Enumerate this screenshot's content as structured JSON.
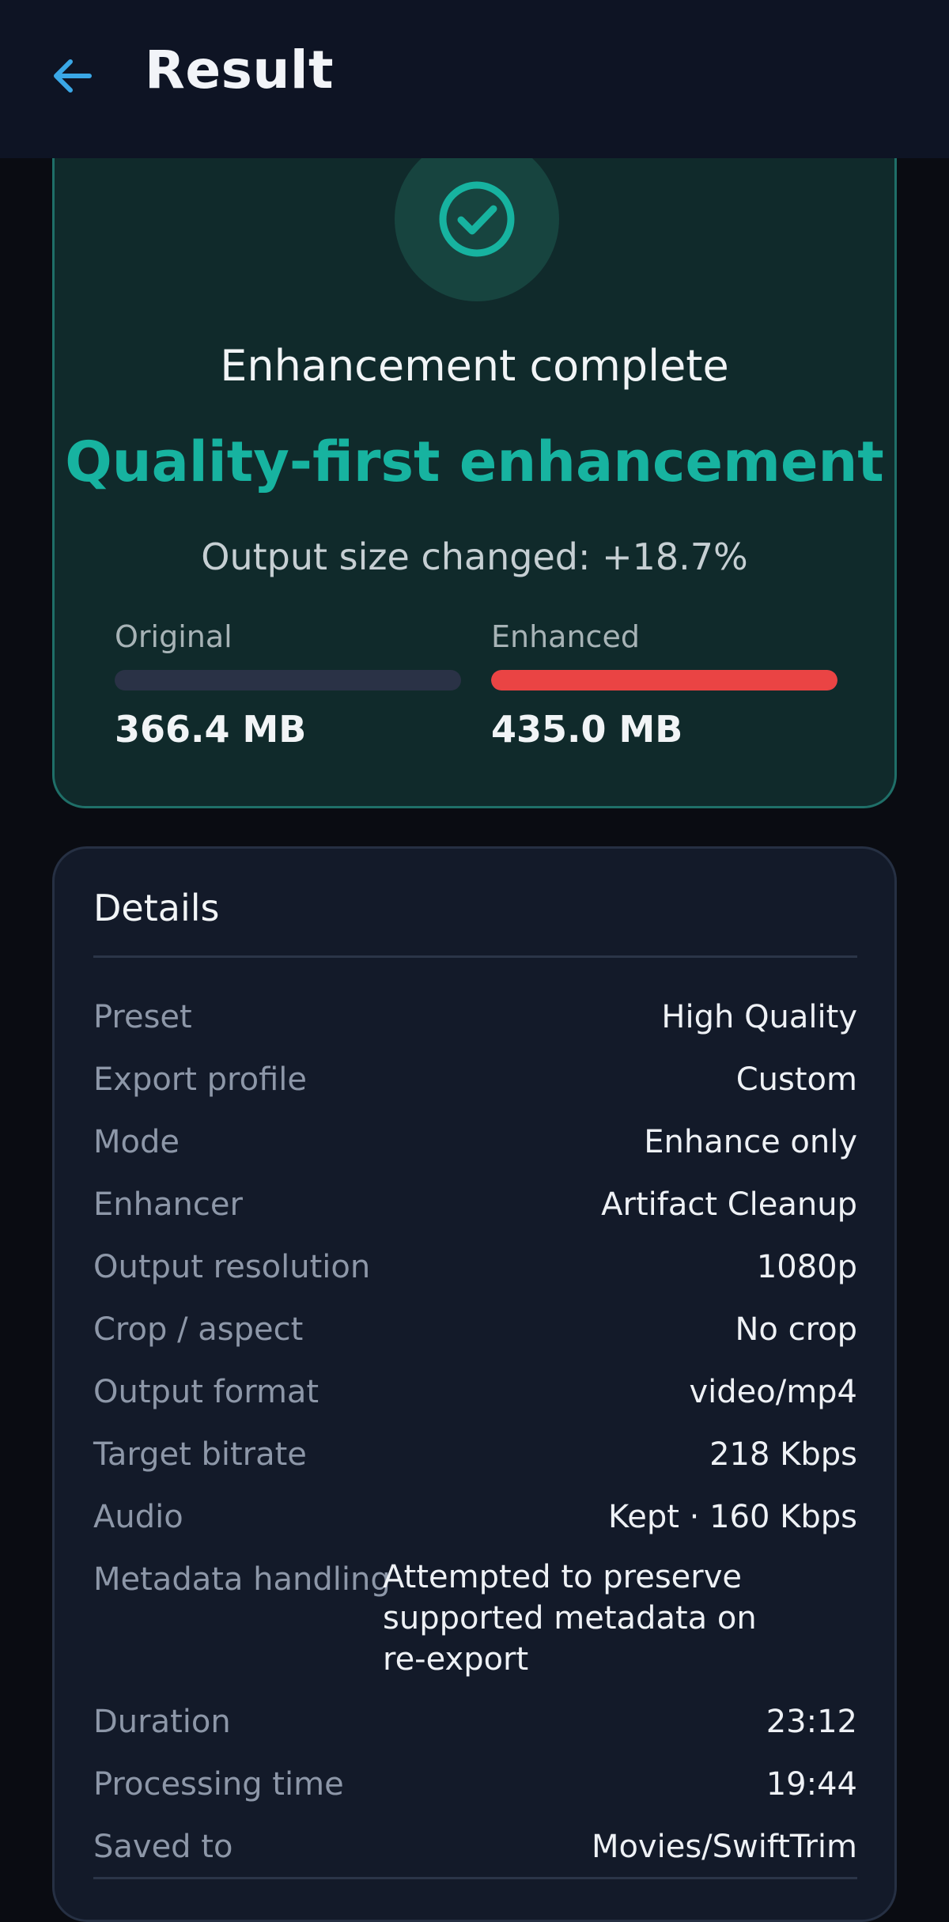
{
  "app_bar": {
    "title": "Result",
    "back_icon": "arrow-left-icon",
    "accent_color": "#3aa7e6"
  },
  "result": {
    "status_icon": "check-circle-icon",
    "title": "Enhancement complete",
    "headline": "Quality-first enhancement",
    "size_change": "Output size changed: +18.7%",
    "original": {
      "label": "Original",
      "value": "366.4 MB",
      "bar_fraction": 0.0,
      "bar_color": "#2a3246"
    },
    "enhanced": {
      "label": "Enhanced",
      "value": "435.0 MB",
      "bar_fraction": 1.0,
      "bar_color": "#ea4444"
    },
    "accent_color": "#17b3a0"
  },
  "details": {
    "title": "Details",
    "rows": [
      {
        "key": "Preset",
        "value": "High Quality"
      },
      {
        "key": "Export profile",
        "value": "Custom"
      },
      {
        "key": "Mode",
        "value": "Enhance only"
      },
      {
        "key": "Enhancer",
        "value": "Artifact Cleanup"
      },
      {
        "key": "Output resolution",
        "value": "1080p"
      },
      {
        "key": "Crop / aspect",
        "value": "No crop"
      },
      {
        "key": "Output format",
        "value": "video/mp4"
      },
      {
        "key": "Target bitrate",
        "value": "218 Kbps"
      },
      {
        "key": "Audio",
        "value": "Kept · 160 Kbps"
      },
      {
        "key": "Metadata handling",
        "value": "Attempted to preserve supported metadata on re-export"
      },
      {
        "key": "Duration",
        "value": "23:12"
      },
      {
        "key": "Processing time",
        "value": "19:44"
      },
      {
        "key": "Saved to",
        "value": "Movies/SwiftTrim"
      }
    ]
  }
}
